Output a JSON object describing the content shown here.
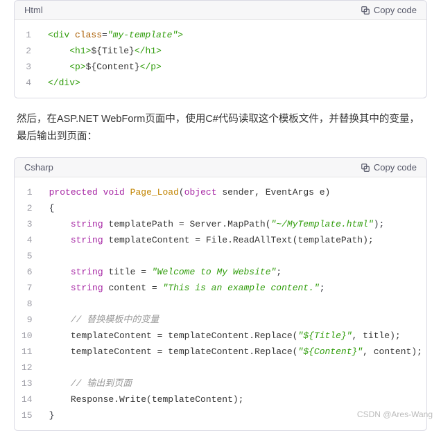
{
  "blocks": {
    "block1": {
      "lang": "Html",
      "copy_label": "Copy code",
      "line_count": 4,
      "lines": {
        "l1": {
          "t1": "<div ",
          "t2": "class",
          "t3": "=",
          "t4a": "\"",
          "t4b": "my-template",
          "t4c": "\"",
          "t5": ">"
        },
        "l2": {
          "indent": "    ",
          "t1": "<h1>",
          "t2": "${Title}",
          "t3": "</h1>"
        },
        "l3": {
          "indent": "    ",
          "t1": "<p>",
          "t2": "${Content}",
          "t3": "</p>"
        },
        "l4": {
          "t1": "</div>"
        }
      }
    },
    "paragraph1": "然后，在ASP.NET WebForm页面中，使用C#代码读取这个模板文件，并替换其中的变量，最后输出到页面：",
    "block2": {
      "lang": "Csharp",
      "copy_label": "Copy code",
      "line_count": 15,
      "lines": {
        "l1": {
          "t1": "protected",
          "sp": " ",
          "t2": "void",
          "sp2": " ",
          "t3": "Page_Load",
          "t4": "(",
          "t5": "object",
          "sp3": " ",
          "t6": "sender, EventArgs e)"
        },
        "l2": {
          "t1": "{"
        },
        "l3": {
          "indent": "    ",
          "t1": "string",
          "sp": " ",
          "t2": "templatePath = Server.MapPath(",
          "t3": "\"~/MyTemplate.html\"",
          "t4": ");"
        },
        "l4": {
          "indent": "    ",
          "t1": "string",
          "sp": " ",
          "t2": "templateContent = File.ReadAllText(templatePath);"
        },
        "l5": {
          "blank": " "
        },
        "l6": {
          "indent": "    ",
          "t1": "string",
          "sp": " ",
          "t2": "title = ",
          "t3": "\"Welcome to My Website\"",
          "t4": ";"
        },
        "l7": {
          "indent": "    ",
          "t1": "string",
          "sp": " ",
          "t2": "content = ",
          "t3": "\"This is an example content.\"",
          "t4": ";"
        },
        "l8": {
          "blank": " "
        },
        "l9": {
          "indent": "    ",
          "t1": "// 替换模板中的变量"
        },
        "l10": {
          "indent": "    ",
          "t1": "templateContent = templateContent.Replace(",
          "t2": "\"${Title}\"",
          "t3": ", title);"
        },
        "l11": {
          "indent": "    ",
          "t1": "templateContent = templateContent.Replace(",
          "t2": "\"${Content}\"",
          "t3": ", content);"
        },
        "l12": {
          "blank": " "
        },
        "l13": {
          "indent": "    ",
          "t1": "// 输出到页面"
        },
        "l14": {
          "indent": "    ",
          "t1": "Response.Write(templateContent);"
        },
        "l15": {
          "t1": "}"
        }
      }
    }
  },
  "watermark": "CSDN @Ares-Wang"
}
